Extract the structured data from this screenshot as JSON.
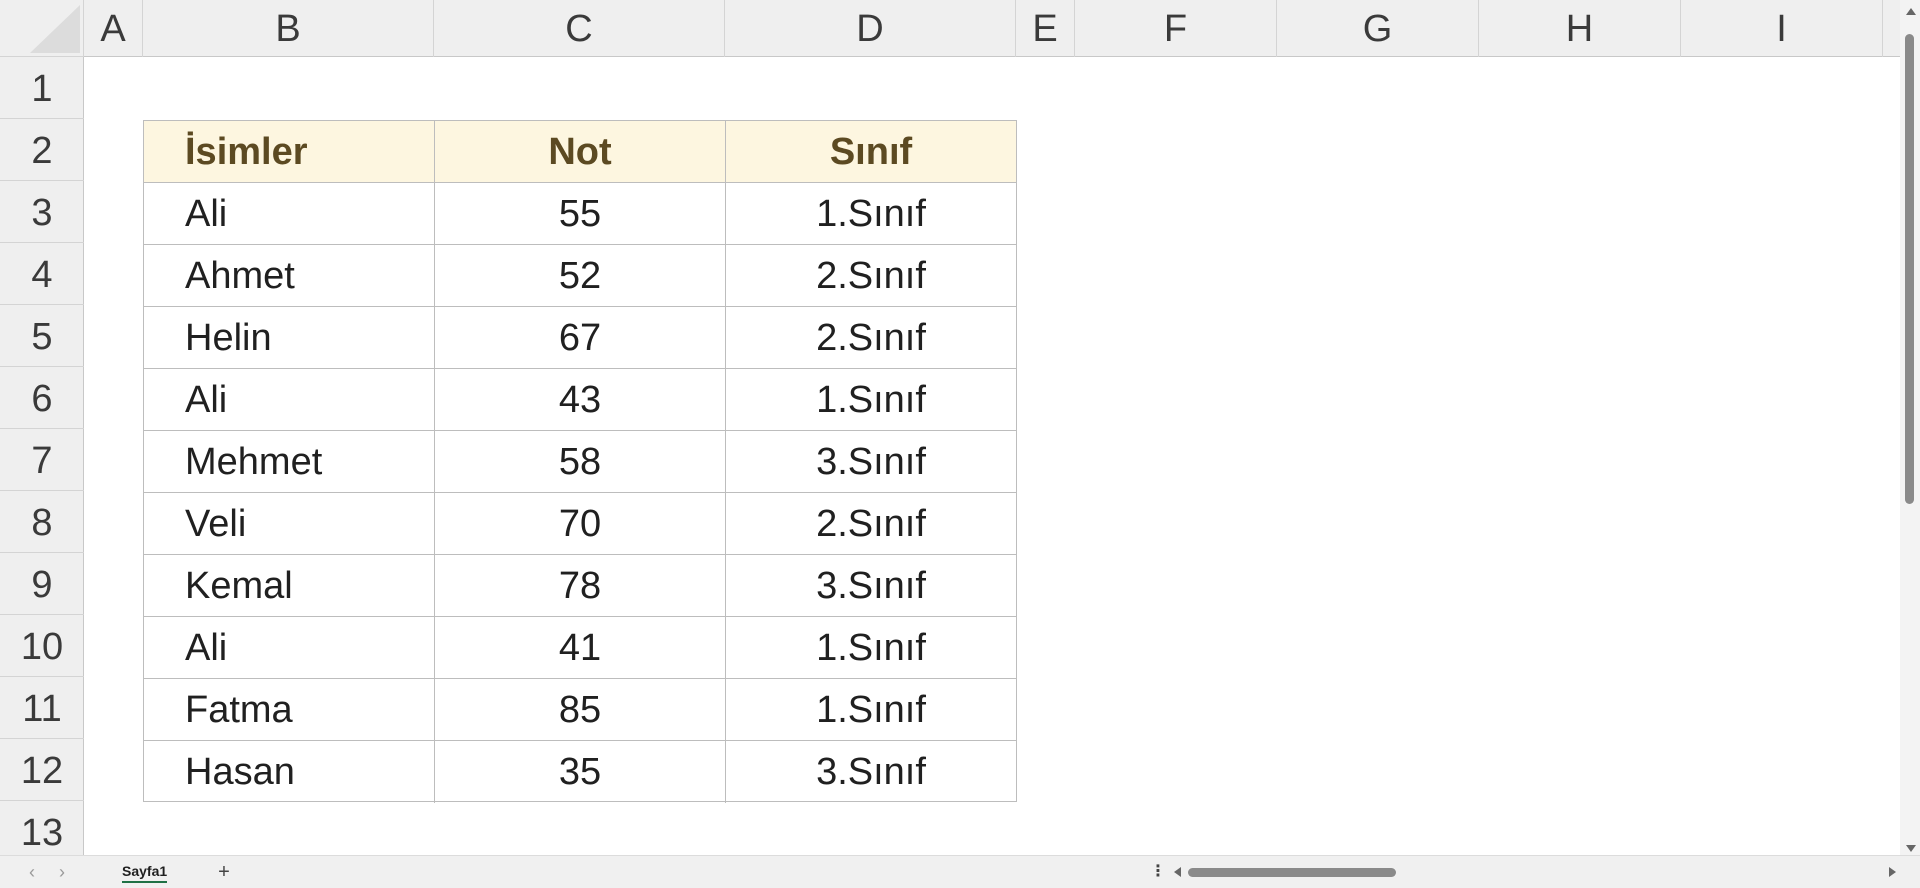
{
  "columns": [
    "A",
    "B",
    "C",
    "D",
    "E",
    "F",
    "G",
    "H",
    "I"
  ],
  "rows": [
    "1",
    "2",
    "3",
    "4",
    "5",
    "6",
    "7",
    "8",
    "9",
    "10",
    "11",
    "12",
    "13"
  ],
  "table": {
    "headers": [
      "İsimler",
      "Not",
      "Sınıf"
    ],
    "rows": [
      [
        "Ali",
        "55",
        "1.Sınıf"
      ],
      [
        "Ahmet",
        "52",
        "2.Sınıf"
      ],
      [
        "Helin",
        "67",
        "2.Sınıf"
      ],
      [
        "Ali",
        "43",
        "1.Sınıf"
      ],
      [
        "Mehmet",
        "58",
        "3.Sınıf"
      ],
      [
        "Veli",
        "70",
        "2.Sınıf"
      ],
      [
        "Kemal",
        "78",
        "3.Sınıf"
      ],
      [
        "Ali",
        "41",
        "1.Sınıf"
      ],
      [
        "Fatma",
        "85",
        "1.Sınıf"
      ],
      [
        "Hasan",
        "35",
        "3.Sınıf"
      ]
    ]
  },
  "tabbar": {
    "prev_label": "‹",
    "next_label": "›",
    "sheet_tab": "Sayfa1",
    "add_label": "+",
    "options_label": "⋮"
  },
  "colors": {
    "header_fill": "#fdf6e0",
    "header_text": "#5c4a22",
    "accent": "#1e7145"
  }
}
